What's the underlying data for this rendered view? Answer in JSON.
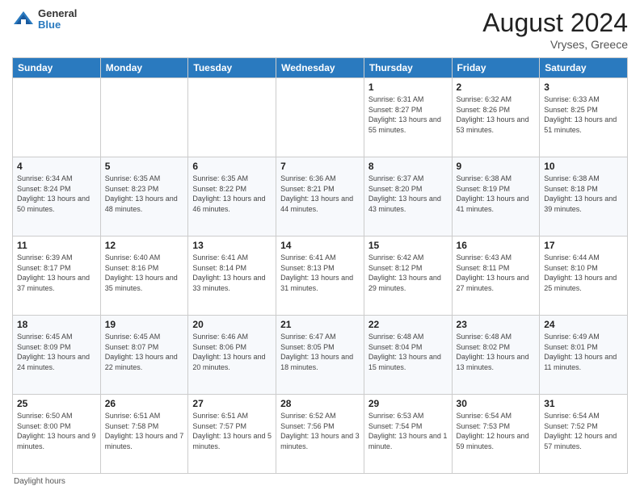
{
  "header": {
    "logo_general": "General",
    "logo_blue": "Blue",
    "month_title": "August 2024",
    "location": "Vryses, Greece"
  },
  "days_of_week": [
    "Sunday",
    "Monday",
    "Tuesday",
    "Wednesday",
    "Thursday",
    "Friday",
    "Saturday"
  ],
  "weeks": [
    [
      {
        "day": "",
        "sunrise": "",
        "sunset": "",
        "daylight": ""
      },
      {
        "day": "",
        "sunrise": "",
        "sunset": "",
        "daylight": ""
      },
      {
        "day": "",
        "sunrise": "",
        "sunset": "",
        "daylight": ""
      },
      {
        "day": "",
        "sunrise": "",
        "sunset": "",
        "daylight": ""
      },
      {
        "day": "1",
        "sunrise": "Sunrise: 6:31 AM",
        "sunset": "Sunset: 8:27 PM",
        "daylight": "Daylight: 13 hours and 55 minutes."
      },
      {
        "day": "2",
        "sunrise": "Sunrise: 6:32 AM",
        "sunset": "Sunset: 8:26 PM",
        "daylight": "Daylight: 13 hours and 53 minutes."
      },
      {
        "day": "3",
        "sunrise": "Sunrise: 6:33 AM",
        "sunset": "Sunset: 8:25 PM",
        "daylight": "Daylight: 13 hours and 51 minutes."
      }
    ],
    [
      {
        "day": "4",
        "sunrise": "Sunrise: 6:34 AM",
        "sunset": "Sunset: 8:24 PM",
        "daylight": "Daylight: 13 hours and 50 minutes."
      },
      {
        "day": "5",
        "sunrise": "Sunrise: 6:35 AM",
        "sunset": "Sunset: 8:23 PM",
        "daylight": "Daylight: 13 hours and 48 minutes."
      },
      {
        "day": "6",
        "sunrise": "Sunrise: 6:35 AM",
        "sunset": "Sunset: 8:22 PM",
        "daylight": "Daylight: 13 hours and 46 minutes."
      },
      {
        "day": "7",
        "sunrise": "Sunrise: 6:36 AM",
        "sunset": "Sunset: 8:21 PM",
        "daylight": "Daylight: 13 hours and 44 minutes."
      },
      {
        "day": "8",
        "sunrise": "Sunrise: 6:37 AM",
        "sunset": "Sunset: 8:20 PM",
        "daylight": "Daylight: 13 hours and 43 minutes."
      },
      {
        "day": "9",
        "sunrise": "Sunrise: 6:38 AM",
        "sunset": "Sunset: 8:19 PM",
        "daylight": "Daylight: 13 hours and 41 minutes."
      },
      {
        "day": "10",
        "sunrise": "Sunrise: 6:38 AM",
        "sunset": "Sunset: 8:18 PM",
        "daylight": "Daylight: 13 hours and 39 minutes."
      }
    ],
    [
      {
        "day": "11",
        "sunrise": "Sunrise: 6:39 AM",
        "sunset": "Sunset: 8:17 PM",
        "daylight": "Daylight: 13 hours and 37 minutes."
      },
      {
        "day": "12",
        "sunrise": "Sunrise: 6:40 AM",
        "sunset": "Sunset: 8:16 PM",
        "daylight": "Daylight: 13 hours and 35 minutes."
      },
      {
        "day": "13",
        "sunrise": "Sunrise: 6:41 AM",
        "sunset": "Sunset: 8:14 PM",
        "daylight": "Daylight: 13 hours and 33 minutes."
      },
      {
        "day": "14",
        "sunrise": "Sunrise: 6:41 AM",
        "sunset": "Sunset: 8:13 PM",
        "daylight": "Daylight: 13 hours and 31 minutes."
      },
      {
        "day": "15",
        "sunrise": "Sunrise: 6:42 AM",
        "sunset": "Sunset: 8:12 PM",
        "daylight": "Daylight: 13 hours and 29 minutes."
      },
      {
        "day": "16",
        "sunrise": "Sunrise: 6:43 AM",
        "sunset": "Sunset: 8:11 PM",
        "daylight": "Daylight: 13 hours and 27 minutes."
      },
      {
        "day": "17",
        "sunrise": "Sunrise: 6:44 AM",
        "sunset": "Sunset: 8:10 PM",
        "daylight": "Daylight: 13 hours and 25 minutes."
      }
    ],
    [
      {
        "day": "18",
        "sunrise": "Sunrise: 6:45 AM",
        "sunset": "Sunset: 8:09 PM",
        "daylight": "Daylight: 13 hours and 24 minutes."
      },
      {
        "day": "19",
        "sunrise": "Sunrise: 6:45 AM",
        "sunset": "Sunset: 8:07 PM",
        "daylight": "Daylight: 13 hours and 22 minutes."
      },
      {
        "day": "20",
        "sunrise": "Sunrise: 6:46 AM",
        "sunset": "Sunset: 8:06 PM",
        "daylight": "Daylight: 13 hours and 20 minutes."
      },
      {
        "day": "21",
        "sunrise": "Sunrise: 6:47 AM",
        "sunset": "Sunset: 8:05 PM",
        "daylight": "Daylight: 13 hours and 18 minutes."
      },
      {
        "day": "22",
        "sunrise": "Sunrise: 6:48 AM",
        "sunset": "Sunset: 8:04 PM",
        "daylight": "Daylight: 13 hours and 15 minutes."
      },
      {
        "day": "23",
        "sunrise": "Sunrise: 6:48 AM",
        "sunset": "Sunset: 8:02 PM",
        "daylight": "Daylight: 13 hours and 13 minutes."
      },
      {
        "day": "24",
        "sunrise": "Sunrise: 6:49 AM",
        "sunset": "Sunset: 8:01 PM",
        "daylight": "Daylight: 13 hours and 11 minutes."
      }
    ],
    [
      {
        "day": "25",
        "sunrise": "Sunrise: 6:50 AM",
        "sunset": "Sunset: 8:00 PM",
        "daylight": "Daylight: 13 hours and 9 minutes."
      },
      {
        "day": "26",
        "sunrise": "Sunrise: 6:51 AM",
        "sunset": "Sunset: 7:58 PM",
        "daylight": "Daylight: 13 hours and 7 minutes."
      },
      {
        "day": "27",
        "sunrise": "Sunrise: 6:51 AM",
        "sunset": "Sunset: 7:57 PM",
        "daylight": "Daylight: 13 hours and 5 minutes."
      },
      {
        "day": "28",
        "sunrise": "Sunrise: 6:52 AM",
        "sunset": "Sunset: 7:56 PM",
        "daylight": "Daylight: 13 hours and 3 minutes."
      },
      {
        "day": "29",
        "sunrise": "Sunrise: 6:53 AM",
        "sunset": "Sunset: 7:54 PM",
        "daylight": "Daylight: 13 hours and 1 minute."
      },
      {
        "day": "30",
        "sunrise": "Sunrise: 6:54 AM",
        "sunset": "Sunset: 7:53 PM",
        "daylight": "Daylight: 12 hours and 59 minutes."
      },
      {
        "day": "31",
        "sunrise": "Sunrise: 6:54 AM",
        "sunset": "Sunset: 7:52 PM",
        "daylight": "Daylight: 12 hours and 57 minutes."
      }
    ]
  ],
  "footer": "Daylight hours"
}
